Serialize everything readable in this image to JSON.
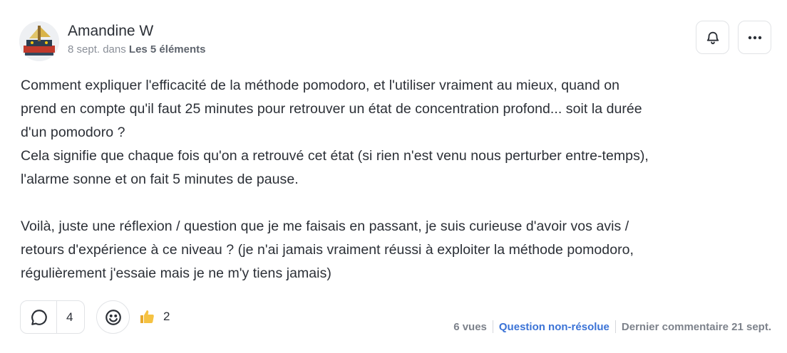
{
  "post": {
    "author": "Amandine W",
    "date": "8 sept.",
    "in_word": "dans",
    "category": "Les 5 éléments",
    "icons": {
      "bell": "bell-icon",
      "more": "more-horizontal-icon"
    },
    "paragraph1": [
      "Comment expliquer l'efficacité de la méthode pomodoro, et l'utiliser vraiment au mieux, quand on",
      "prend en compte qu'il faut 25 minutes pour retrouver un état de concentration profond... soit la durée",
      "d'un pomodoro ?",
      "Cela signifie que chaque fois qu'on a retrouvé cet état (si rien n'est venu nous perturber entre-temps),",
      "l'alarme sonne et on fait 5 minutes de pause."
    ],
    "paragraph2": [
      "Voilà, juste une réflexion / question que je me faisais en passant, je suis curieuse d'avoir vos avis /",
      "retours d'expérience à ce niveau ? (je n'ai jamais vraiment réussi à exploiter la méthode pomodoro,",
      "régulièrement j'essaie mais je ne m'y tiens jamais)"
    ]
  },
  "footer": {
    "reply_count": "4",
    "reaction_emoji": "👍",
    "reaction_count": "2",
    "views": "6 vues",
    "status": "Question non-résolue",
    "last_comment": "Dernier commentaire 21 sept."
  },
  "colors": {
    "status_blue": "#3b73d6",
    "muted": "#7d828b",
    "border": "#e1e3e6"
  }
}
